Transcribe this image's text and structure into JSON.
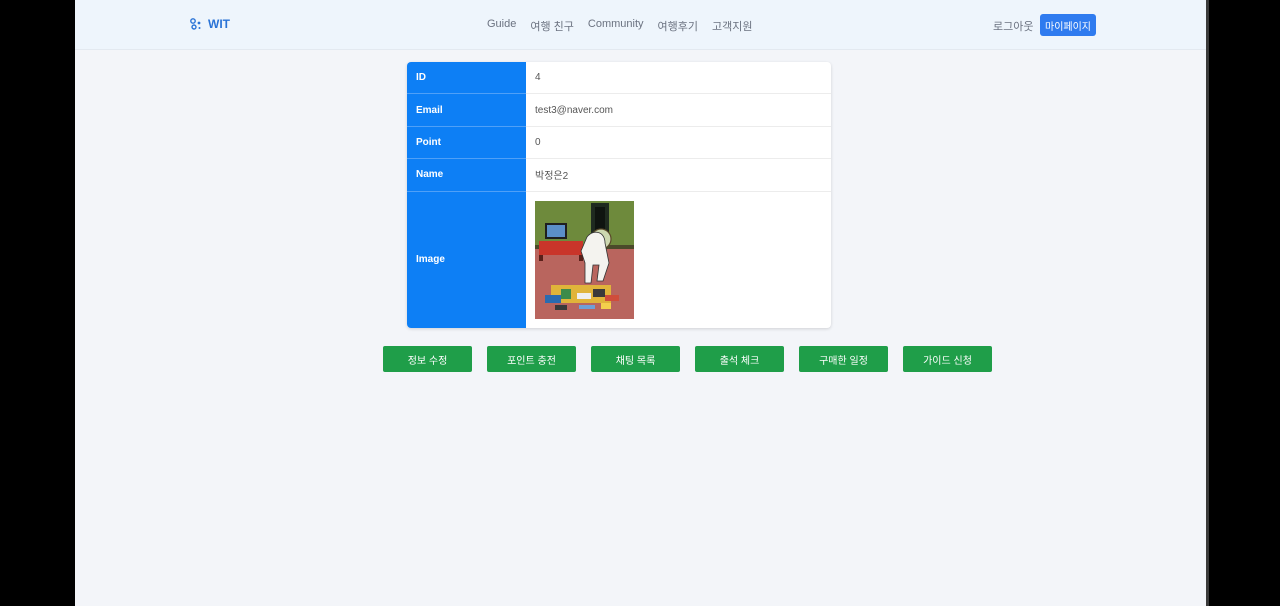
{
  "nav": {
    "logo_text": "WIT",
    "links": [
      "Guide",
      "여행 친구",
      "Community",
      "여행후기",
      "고객지원"
    ],
    "logout": "로그아웃",
    "mypage": "마이페이지"
  },
  "profile": {
    "rows": [
      {
        "label": "ID",
        "value": "4"
      },
      {
        "label": "Email",
        "value": "test3@naver.com"
      },
      {
        "label": "Point",
        "value": "0"
      },
      {
        "label": "Name",
        "value": "박정은2"
      }
    ],
    "image_label": "Image"
  },
  "actions": [
    "정보 수정",
    "포인트 충전",
    "채팅 목록",
    "출석 체크",
    "구매한 일정",
    "가이드 신청"
  ],
  "colors": {
    "brand": "#2a73d6",
    "primary_button": "#2f7bef",
    "table_header": "#0d7ff5",
    "action_button": "#1f9e49",
    "page_bg": "#f3f5f9",
    "nav_bg": "#eef5fc"
  },
  "icons": {
    "logo": "wit-logo-icon"
  }
}
